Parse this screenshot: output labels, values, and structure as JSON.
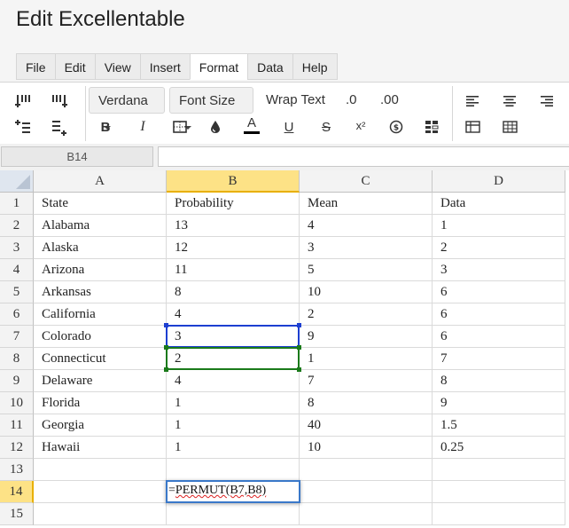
{
  "app": {
    "title": "Edit Excellentable"
  },
  "menu": {
    "tabs": [
      "File",
      "Edit",
      "View",
      "Insert",
      "Format",
      "Data",
      "Help"
    ],
    "active_index": 4
  },
  "toolbar": {
    "font_family": "Verdana",
    "font_size_label": "Font Size",
    "wrap_text_label": "Wrap Text",
    "decimal_decrease_label": ".0",
    "decimal_increase_label": ".00",
    "bold_label": "B",
    "italic_label": "I",
    "text_color_label": "A",
    "underline_label": "U",
    "strike_label": "S",
    "superscript_label": "x²",
    "text_color_bar": "#000000",
    "icons": [
      "insert-column-left-icon",
      "insert-column-right-icon",
      "insert-row-above-icon",
      "insert-row-below-icon",
      "borders-icon",
      "fill-color-icon",
      "currency-icon",
      "conditional-format-icon",
      "align-left-icon",
      "align-center-icon",
      "align-right-icon",
      "table-icon",
      "grid-icon"
    ]
  },
  "formula_bar": {
    "name_box": "B14",
    "formula": ""
  },
  "sheet": {
    "columns": [
      "A",
      "B",
      "C",
      "D"
    ],
    "selected_column": "B",
    "row_numbers": [
      "1",
      "2",
      "3",
      "4",
      "5",
      "6",
      "7",
      "8",
      "9",
      "10",
      "11",
      "12",
      "13",
      "14",
      "15"
    ],
    "selected_row": "14",
    "rows": [
      [
        "State",
        "Probability",
        "Mean",
        "Data"
      ],
      [
        "Alabama",
        "13",
        "4",
        "1"
      ],
      [
        "Alaska",
        "12",
        "3",
        "2"
      ],
      [
        "Arizona",
        "11",
        "5",
        "3"
      ],
      [
        "Arkansas",
        "8",
        "10",
        "6"
      ],
      [
        "California",
        "4",
        "2",
        "6"
      ],
      [
        "Colorado",
        "3",
        "9",
        "6"
      ],
      [
        "Connecticut",
        "2",
        "1",
        "7"
      ],
      [
        "Delaware",
        "4",
        "7",
        "8"
      ],
      [
        "Florida",
        "1",
        "8",
        "9"
      ],
      [
        "Georgia",
        "1",
        "40",
        "1.5"
      ],
      [
        "Hawaii",
        "1",
        "10",
        "0.25"
      ],
      [
        "",
        "",
        "",
        ""
      ],
      [
        "",
        "",
        "",
        ""
      ],
      [
        "",
        "",
        "",
        ""
      ]
    ],
    "editing_cell": "B14",
    "editor_prefix": "=",
    "editor_text": "PERMUT(B7,B8)",
    "reference_highlights": [
      {
        "cell": "B7",
        "color": "#1d3fd1"
      },
      {
        "cell": "B8",
        "color": "#1a7a1a"
      }
    ]
  },
  "colors": {
    "selected_header": "#fde286",
    "editor_border": "#3a78c9"
  }
}
